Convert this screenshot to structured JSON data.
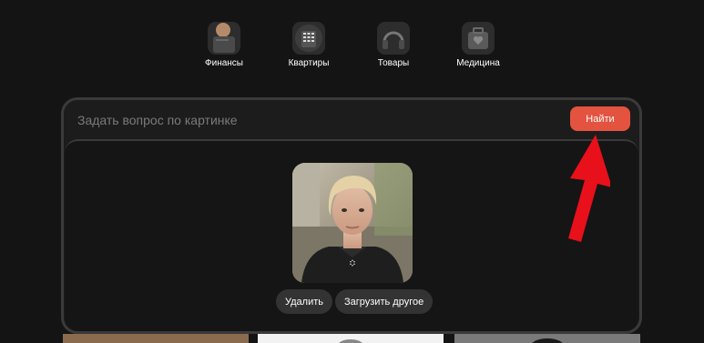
{
  "services": [
    {
      "label": "Финансы",
      "icon": "finance-icon"
    },
    {
      "label": "Квартиры",
      "icon": "apartments-icon"
    },
    {
      "label": "Товары",
      "icon": "headphones-icon"
    },
    {
      "label": "Медицина",
      "icon": "medical-kit-icon"
    }
  ],
  "search": {
    "placeholder": "Задать вопрос по картинке",
    "value": "",
    "submit_label": "Найти"
  },
  "preview": {
    "delete_label": "Удалить",
    "upload_other_label": "Загрузить другое"
  },
  "colors": {
    "background": "#141414",
    "accent": "#e3533f",
    "annotation_arrow": "#e8101a"
  }
}
